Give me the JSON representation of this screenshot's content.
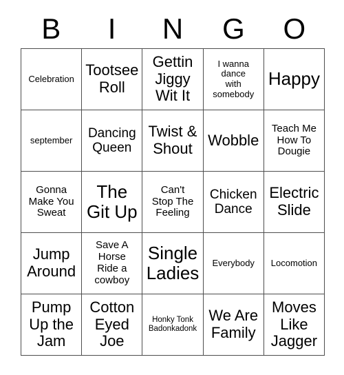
{
  "card": {
    "header_letters": [
      "B",
      "I",
      "N",
      "G",
      "O"
    ],
    "columns": 5,
    "rows": 5,
    "border_color": "#4d4d4d",
    "text_color": "#000000",
    "background_color": "#ffffff",
    "cells": [
      [
        {
          "text": "Celebration",
          "size": "sm"
        },
        {
          "text": "Tootsee\nRoll",
          "size": "xl"
        },
        {
          "text": "Gettin\nJiggy\nWit It",
          "size": "xl"
        },
        {
          "text": "I wanna\ndance\nwith\nsomebody",
          "size": "sm"
        },
        {
          "text": "Happy",
          "size": "xxl"
        }
      ],
      [
        {
          "text": "september",
          "size": "sm"
        },
        {
          "text": "Dancing\nQueen",
          "size": "lg"
        },
        {
          "text": "Twist &\nShout",
          "size": "xl"
        },
        {
          "text": "Wobble",
          "size": "xl"
        },
        {
          "text": "Teach Me\nHow To\nDougie",
          "size": "md"
        }
      ],
      [
        {
          "text": "Gonna\nMake You\nSweat",
          "size": "md"
        },
        {
          "text": "The\nGit Up",
          "size": "xxl"
        },
        {
          "text": "Can't\nStop The\nFeeling",
          "size": "md"
        },
        {
          "text": "Chicken\nDance",
          "size": "lg"
        },
        {
          "text": "Electric\nSlide",
          "size": "xl"
        }
      ],
      [
        {
          "text": "Jump\nAround",
          "size": "xl"
        },
        {
          "text": "Save A\nHorse\nRide a\ncowboy",
          "size": "md"
        },
        {
          "text": "Single\nLadies",
          "size": "xxl"
        },
        {
          "text": "Everybody",
          "size": "sm"
        },
        {
          "text": "Locomotion",
          "size": "sm"
        }
      ],
      [
        {
          "text": "Pump\nUp the\nJam",
          "size": "xl"
        },
        {
          "text": "Cotton\nEyed\nJoe",
          "size": "xl"
        },
        {
          "text": "Honky Tonk\nBadonkadonk",
          "size": "xs"
        },
        {
          "text": "We Are\nFamily",
          "size": "xl"
        },
        {
          "text": "Moves\nLike\nJagger",
          "size": "xl"
        }
      ]
    ]
  }
}
